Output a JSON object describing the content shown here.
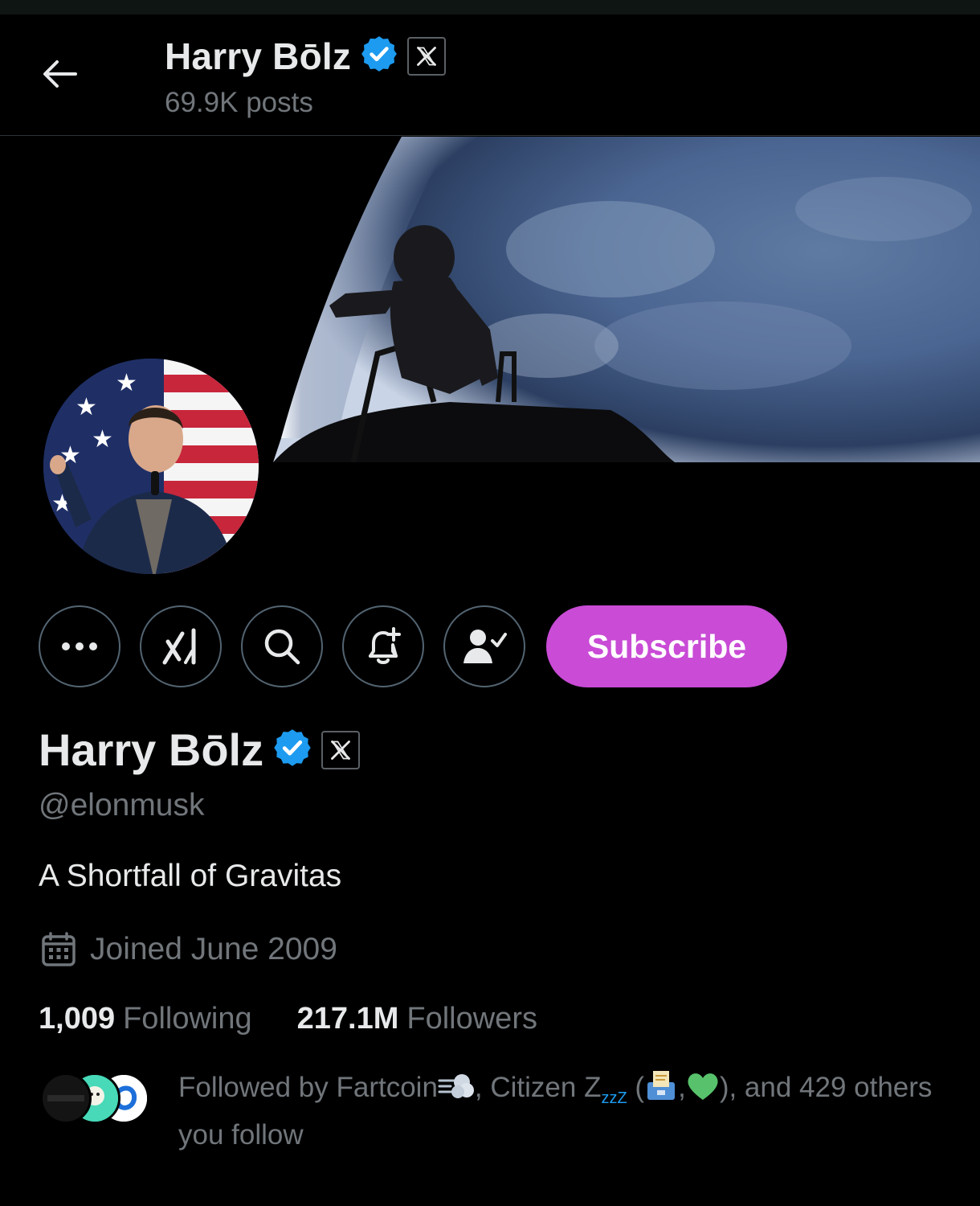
{
  "header": {
    "name": "Harry Bōlz",
    "posts": "69.9K posts"
  },
  "actions": {
    "subscribe_label": "Subscribe"
  },
  "profile": {
    "name": "Harry Bōlz",
    "handle": "@elonmusk",
    "bio": "A Shortfall of Gravitas",
    "joined": "Joined June 2009",
    "following_count": "1,009",
    "following_label": "Following",
    "followers_count": "217.1M",
    "followers_label": "Followers"
  },
  "followed_by": {
    "prefix": "Followed by Fartcoin",
    "mid1": ", Citizen Z",
    "zzz": "zzZ",
    "open_paren": " (",
    "comma": ",",
    "suffix": "), and 429 others you follow"
  },
  "colors": {
    "subscribe": "#c94bd6",
    "verified": "#1d9bf0",
    "muted_text": "#71767b"
  },
  "icons": [
    "arrow-left-icon",
    "verified-badge-icon",
    "x-logo-badge-icon",
    "more-icon",
    "grok-icon",
    "search-icon",
    "bell-plus-icon",
    "person-check-icon",
    "calendar-icon"
  ]
}
